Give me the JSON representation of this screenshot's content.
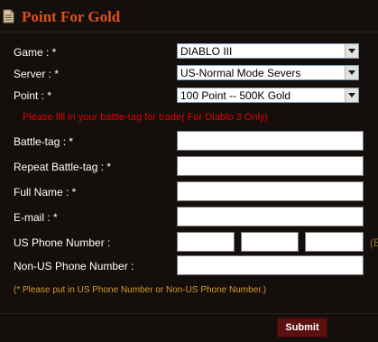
{
  "header": {
    "title": "Point For Gold",
    "icon": "document-icon"
  },
  "form": {
    "game": {
      "label": "Game : *",
      "value": "DIABLO III"
    },
    "server": {
      "label": "Server : *",
      "value": "US-Normal Mode Severs"
    },
    "point": {
      "label": "Point : *",
      "value": "100 Point -- 500K Gold"
    },
    "hint": "Please fill in your battle-tag for trade( For Diablo 3 Only)",
    "battle_tag": {
      "label": "Battle-tag : *",
      "value": ""
    },
    "repeat_battle_tag": {
      "label": "Repeat Battle-tag : *",
      "value": ""
    },
    "full_name": {
      "label": "Full Name : *",
      "value": ""
    },
    "email": {
      "label": "E-mail : *",
      "value": ""
    },
    "us_phone": {
      "label": "US Phone Number :",
      "trailing": "(E"
    },
    "non_us_phone": {
      "label": "Non-US Phone Number :",
      "value": ""
    },
    "note": "(* Please put in US Phone Number or Non-US Phone Number.)",
    "submit_label": "Submit"
  },
  "colors": {
    "background": "#140f0c",
    "title": "#e0501e",
    "hint": "#e00000",
    "note": "#d69a2a",
    "submit": "#5c0f0f"
  }
}
